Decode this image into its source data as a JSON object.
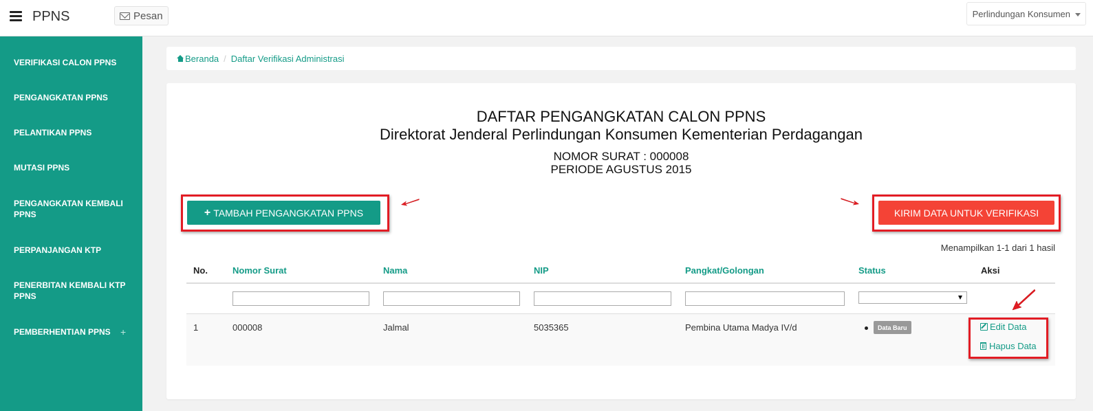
{
  "navbar": {
    "brand": "PPNS",
    "pesan_label": "Pesan",
    "org_select": "Perlindungan Konsumen"
  },
  "sidebar": {
    "items": [
      {
        "label": "VERIFIKASI CALON PPNS"
      },
      {
        "label": "PENGANGKATAN PPNS"
      },
      {
        "label": "PELANTIKAN PPNS"
      },
      {
        "label": "MUTASI PPNS"
      },
      {
        "label": "PENGANGKATAN KEMBALI PPNS"
      },
      {
        "label": "PERPANJANGAN KTP"
      },
      {
        "label": "PENERBITAN KEMBALI KTP PPNS"
      },
      {
        "label": "PEMBERHENTIAN PPNS"
      }
    ],
    "expand_symbol": "+"
  },
  "breadcrumb": {
    "home": "Beranda",
    "separator": "/",
    "current": "Daftar Verifikasi Administrasi"
  },
  "page": {
    "title": "DAFTAR PENGANGKATAN CALON PPNS",
    "subtitle": "Direktorat Jenderal Perlindungan Konsumen Kementerian Perdagangan",
    "nomor_surat": "NOMOR SURAT : 000008",
    "periode": "PERIODE AGUSTUS 2015"
  },
  "actions": {
    "add_label": "TAMBAH PENGANGKATAN PPNS",
    "add_symbol": "+",
    "send_label": "KIRIM DATA UNTUK VERIFIKASI"
  },
  "summary": "Menampilkan 1-1 dari 1 hasil",
  "table": {
    "columns": [
      "No.",
      "Nomor Surat",
      "Nama",
      "NIP",
      "Pangkat/Golongan",
      "Status",
      "Aksi"
    ],
    "rows": [
      {
        "no": "1",
        "nomor_surat": "000008",
        "nama": "Jalmal",
        "nip": "5035365",
        "pangkat": "Pembina Utama Madya IV/d",
        "status": "Data Baru",
        "edit_label": "Edit Data",
        "hapus_label": "Hapus Data"
      }
    ]
  },
  "colors": {
    "primary": "#149b87",
    "danger": "#f44336",
    "highlight": "#e21c24",
    "badge": "#999999"
  }
}
